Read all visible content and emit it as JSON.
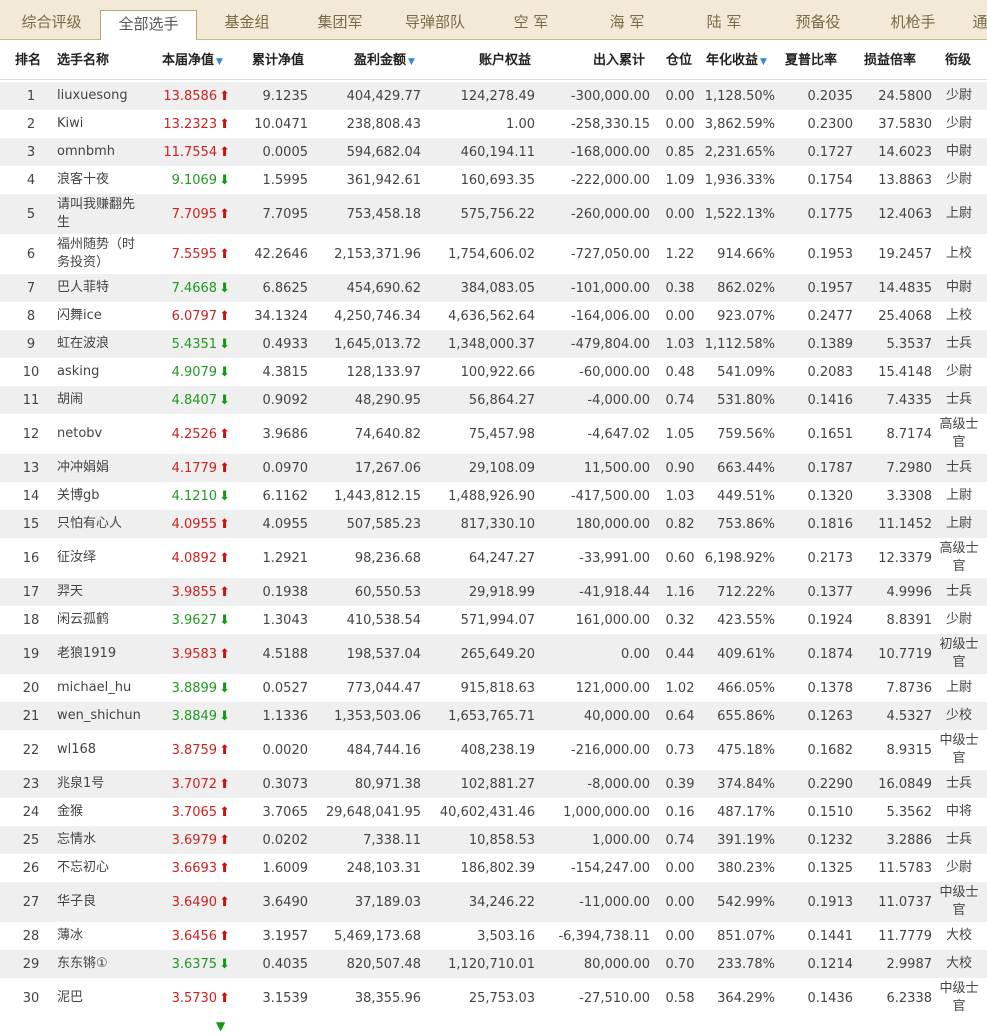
{
  "tabs": [
    {
      "label": "综合评级",
      "active": false
    },
    {
      "label": "全部选手",
      "active": true
    },
    {
      "label": "基金组",
      "active": false
    },
    {
      "label": "集团军",
      "active": false
    },
    {
      "label": "导弹部队",
      "active": false
    },
    {
      "label": "空 军",
      "active": false
    },
    {
      "label": "海 军",
      "active": false
    },
    {
      "label": "陆 军",
      "active": false
    },
    {
      "label": "预备役",
      "active": false
    },
    {
      "label": "机枪手",
      "active": false
    },
    {
      "label": "通",
      "active": false
    }
  ],
  "columns": {
    "rank": "排名",
    "name": "选手名称",
    "nav": "本届净值",
    "cum_nav": "累计净值",
    "profit": "盈利金额",
    "equity": "账户权益",
    "flow": "出入累计",
    "position": "仓位",
    "annual": "年化收益",
    "sharpe": "夏普比率",
    "pl_ratio": "损益倍率",
    "title": "衔级"
  },
  "sort_indicator": "▼",
  "arrow_icons": {
    "up": "arrow-up-icon",
    "down": "arrow-down-icon"
  },
  "colors": {
    "up": "#cc2222",
    "down": "#229922",
    "sort": "#3b8ad6",
    "tabbar": "#f2ead6"
  },
  "rows": [
    {
      "rank": "1",
      "name": "liuxuesong",
      "nav": "13.8586",
      "dir": "up",
      "cum_nav": "9.1235",
      "profit": "404,429.77",
      "equity": "124,278.49",
      "flow": "-300,000.00",
      "position": "0.00",
      "annual": "1,128.50%",
      "sharpe": "0.2035",
      "pl_ratio": "24.5800",
      "title": "少尉"
    },
    {
      "rank": "2",
      "name": "Kiwi",
      "nav": "13.2323",
      "dir": "up",
      "cum_nav": "10.0471",
      "profit": "238,808.43",
      "equity": "1.00",
      "flow": "-258,330.15",
      "position": "0.00",
      "annual": "3,862.59%",
      "sharpe": "0.2300",
      "pl_ratio": "37.5830",
      "title": "少尉"
    },
    {
      "rank": "3",
      "name": "omnbmh",
      "nav": "11.7554",
      "dir": "up",
      "cum_nav": "0.0005",
      "profit": "594,682.04",
      "equity": "460,194.11",
      "flow": "-168,000.00",
      "position": "0.85",
      "annual": "2,231.65%",
      "sharpe": "0.1727",
      "pl_ratio": "14.6023",
      "title": "中尉"
    },
    {
      "rank": "4",
      "name": "浪客十夜",
      "nav": "9.1069",
      "dir": "down",
      "cum_nav": "1.5995",
      "profit": "361,942.61",
      "equity": "160,693.35",
      "flow": "-222,000.00",
      "position": "1.09",
      "annual": "1,936.33%",
      "sharpe": "0.1754",
      "pl_ratio": "13.8863",
      "title": "少尉"
    },
    {
      "rank": "5",
      "name": "请叫我赚翻先生",
      "nav": "7.7095",
      "dir": "up",
      "cum_nav": "7.7095",
      "profit": "753,458.18",
      "equity": "575,756.22",
      "flow": "-260,000.00",
      "position": "0.00",
      "annual": "1,522.13%",
      "sharpe": "0.1775",
      "pl_ratio": "12.4063",
      "title": "上尉"
    },
    {
      "rank": "6",
      "name": "福州随势（时务投资）",
      "nav": "7.5595",
      "dir": "up",
      "cum_nav": "42.2646",
      "profit": "2,153,371.96",
      "equity": "1,754,606.02",
      "flow": "-727,050.00",
      "position": "1.22",
      "annual": "914.66%",
      "sharpe": "0.1953",
      "pl_ratio": "19.2457",
      "title": "上校"
    },
    {
      "rank": "7",
      "name": "巴人菲特",
      "nav": "7.4668",
      "dir": "down",
      "cum_nav": "6.8625",
      "profit": "454,690.62",
      "equity": "384,083.05",
      "flow": "-101,000.00",
      "position": "0.38",
      "annual": "862.02%",
      "sharpe": "0.1957",
      "pl_ratio": "14.4835",
      "title": "中尉"
    },
    {
      "rank": "8",
      "name": "闪舞ice",
      "nav": "6.0797",
      "dir": "up",
      "cum_nav": "34.1324",
      "profit": "4,250,746.34",
      "equity": "4,636,562.64",
      "flow": "-164,006.00",
      "position": "0.00",
      "annual": "923.07%",
      "sharpe": "0.2477",
      "pl_ratio": "25.4068",
      "title": "上校"
    },
    {
      "rank": "9",
      "name": "虹在波浪",
      "nav": "5.4351",
      "dir": "down",
      "cum_nav": "0.4933",
      "profit": "1,645,013.72",
      "equity": "1,348,000.37",
      "flow": "-479,804.00",
      "position": "1.03",
      "annual": "1,112.58%",
      "sharpe": "0.1389",
      "pl_ratio": "5.3537",
      "title": "士兵"
    },
    {
      "rank": "10",
      "name": "asking",
      "nav": "4.9079",
      "dir": "down",
      "cum_nav": "4.3815",
      "profit": "128,133.97",
      "equity": "100,922.66",
      "flow": "-60,000.00",
      "position": "0.48",
      "annual": "541.09%",
      "sharpe": "0.2083",
      "pl_ratio": "15.4148",
      "title": "少尉"
    },
    {
      "rank": "11",
      "name": "胡闹",
      "nav": "4.8407",
      "dir": "down",
      "cum_nav": "0.9092",
      "profit": "48,290.95",
      "equity": "56,864.27",
      "flow": "-4,000.00",
      "position": "0.74",
      "annual": "531.80%",
      "sharpe": "0.1416",
      "pl_ratio": "7.4335",
      "title": "士兵"
    },
    {
      "rank": "12",
      "name": "netobv",
      "nav": "4.2526",
      "dir": "up",
      "cum_nav": "3.9686",
      "profit": "74,640.82",
      "equity": "75,457.98",
      "flow": "-4,647.02",
      "position": "1.05",
      "annual": "759.56%",
      "sharpe": "0.1651",
      "pl_ratio": "8.7174",
      "title": "高级士官"
    },
    {
      "rank": "13",
      "name": "冲冲娟娟",
      "nav": "4.1779",
      "dir": "up",
      "cum_nav": "0.0970",
      "profit": "17,267.06",
      "equity": "29,108.09",
      "flow": "11,500.00",
      "position": "0.90",
      "annual": "663.44%",
      "sharpe": "0.1787",
      "pl_ratio": "7.2980",
      "title": "士兵"
    },
    {
      "rank": "14",
      "name": "关博gb",
      "nav": "4.1210",
      "dir": "down",
      "cum_nav": "6.1162",
      "profit": "1,443,812.15",
      "equity": "1,488,926.90",
      "flow": "-417,500.00",
      "position": "1.03",
      "annual": "449.51%",
      "sharpe": "0.1320",
      "pl_ratio": "3.3308",
      "title": "上尉"
    },
    {
      "rank": "15",
      "name": "只怕有心人",
      "nav": "4.0955",
      "dir": "up",
      "cum_nav": "4.0955",
      "profit": "507,585.23",
      "equity": "817,330.10",
      "flow": "180,000.00",
      "position": "0.82",
      "annual": "753.86%",
      "sharpe": "0.1816",
      "pl_ratio": "11.1452",
      "title": "上尉"
    },
    {
      "rank": "16",
      "name": "征汝绎",
      "nav": "4.0892",
      "dir": "up",
      "cum_nav": "1.2921",
      "profit": "98,236.68",
      "equity": "64,247.27",
      "flow": "-33,991.00",
      "position": "0.60",
      "annual": "6,198.92%",
      "sharpe": "0.2173",
      "pl_ratio": "12.3379",
      "title": "高级士官"
    },
    {
      "rank": "17",
      "name": "羿天",
      "nav": "3.9855",
      "dir": "up",
      "cum_nav": "0.1938",
      "profit": "60,550.53",
      "equity": "29,918.99",
      "flow": "-41,918.44",
      "position": "1.16",
      "annual": "712.22%",
      "sharpe": "0.1377",
      "pl_ratio": "4.9996",
      "title": "士兵"
    },
    {
      "rank": "18",
      "name": "闲云孤鹤",
      "nav": "3.9627",
      "dir": "down",
      "cum_nav": "1.3043",
      "profit": "410,538.54",
      "equity": "571,994.07",
      "flow": "161,000.00",
      "position": "0.32",
      "annual": "423.55%",
      "sharpe": "0.1924",
      "pl_ratio": "8.8391",
      "title": "少尉"
    },
    {
      "rank": "19",
      "name": "老狼1919",
      "nav": "3.9583",
      "dir": "up",
      "cum_nav": "4.5188",
      "profit": "198,537.04",
      "equity": "265,649.20",
      "flow": "0.00",
      "position": "0.44",
      "annual": "409.61%",
      "sharpe": "0.1874",
      "pl_ratio": "10.7719",
      "title": "初级士官"
    },
    {
      "rank": "20",
      "name": "michael_hu",
      "nav": "3.8899",
      "dir": "down",
      "cum_nav": "0.0527",
      "profit": "773,044.47",
      "equity": "915,818.63",
      "flow": "121,000.00",
      "position": "1.02",
      "annual": "466.05%",
      "sharpe": "0.1378",
      "pl_ratio": "7.8736",
      "title": "上尉"
    },
    {
      "rank": "21",
      "name": "wen_shichun",
      "nav": "3.8849",
      "dir": "down",
      "cum_nav": "1.1336",
      "profit": "1,353,503.06",
      "equity": "1,653,765.71",
      "flow": "40,000.00",
      "position": "0.64",
      "annual": "655.86%",
      "sharpe": "0.1263",
      "pl_ratio": "4.5327",
      "title": "少校"
    },
    {
      "rank": "22",
      "name": "wl168",
      "nav": "3.8759",
      "dir": "up",
      "cum_nav": "0.0020",
      "profit": "484,744.16",
      "equity": "408,238.19",
      "flow": "-216,000.00",
      "position": "0.73",
      "annual": "475.18%",
      "sharpe": "0.1682",
      "pl_ratio": "8.9315",
      "title": "中级士官"
    },
    {
      "rank": "23",
      "name": "兆泉1号",
      "nav": "3.7072",
      "dir": "up",
      "cum_nav": "0.3073",
      "profit": "80,971.38",
      "equity": "102,881.27",
      "flow": "-8,000.00",
      "position": "0.39",
      "annual": "374.84%",
      "sharpe": "0.2290",
      "pl_ratio": "16.0849",
      "title": "士兵"
    },
    {
      "rank": "24",
      "name": "金猴",
      "nav": "3.7065",
      "dir": "up",
      "cum_nav": "3.7065",
      "profit": "29,648,041.95",
      "equity": "40,602,431.46",
      "flow": "1,000,000.00",
      "position": "0.16",
      "annual": "487.17%",
      "sharpe": "0.1510",
      "pl_ratio": "5.3562",
      "title": "中将"
    },
    {
      "rank": "25",
      "name": "忘情水",
      "nav": "3.6979",
      "dir": "up",
      "cum_nav": "0.0202",
      "profit": "7,338.11",
      "equity": "10,858.53",
      "flow": "1,000.00",
      "position": "0.74",
      "annual": "391.19%",
      "sharpe": "0.1232",
      "pl_ratio": "3.2886",
      "title": "士兵"
    },
    {
      "rank": "26",
      "name": "不忘初心",
      "nav": "3.6693",
      "dir": "up",
      "cum_nav": "1.6009",
      "profit": "248,103.31",
      "equity": "186,802.39",
      "flow": "-154,247.00",
      "position": "0.00",
      "annual": "380.23%",
      "sharpe": "0.1325",
      "pl_ratio": "11.5783",
      "title": "少尉"
    },
    {
      "rank": "27",
      "name": "华子良",
      "nav": "3.6490",
      "dir": "up",
      "cum_nav": "3.6490",
      "profit": "37,189.03",
      "equity": "34,246.22",
      "flow": "-11,000.00",
      "position": "0.00",
      "annual": "542.99%",
      "sharpe": "0.1913",
      "pl_ratio": "11.0737",
      "title": "中级士官"
    },
    {
      "rank": "28",
      "name": "薄冰",
      "nav": "3.6456",
      "dir": "up",
      "cum_nav": "3.1957",
      "profit": "5,469,173.68",
      "equity": "3,503.16",
      "flow": "-6,394,738.11",
      "position": "0.00",
      "annual": "851.07%",
      "sharpe": "0.1441",
      "pl_ratio": "11.7779",
      "title": "大校"
    },
    {
      "rank": "29",
      "name": "东东锵①",
      "nav": "3.6375",
      "dir": "down",
      "cum_nav": "0.4035",
      "profit": "820,507.48",
      "equity": "1,120,710.01",
      "flow": "80,000.00",
      "position": "0.70",
      "annual": "233.78%",
      "sharpe": "0.1214",
      "pl_ratio": "2.9987",
      "title": "大校"
    },
    {
      "rank": "30",
      "name": "泥巴",
      "nav": "3.5730",
      "dir": "up",
      "cum_nav": "3.1539",
      "profit": "38,355.96",
      "equity": "25,753.03",
      "flow": "-27,510.00",
      "position": "0.58",
      "annual": "364.29%",
      "sharpe": "0.1436",
      "pl_ratio": "6.2338",
      "title": "中级士官"
    }
  ]
}
